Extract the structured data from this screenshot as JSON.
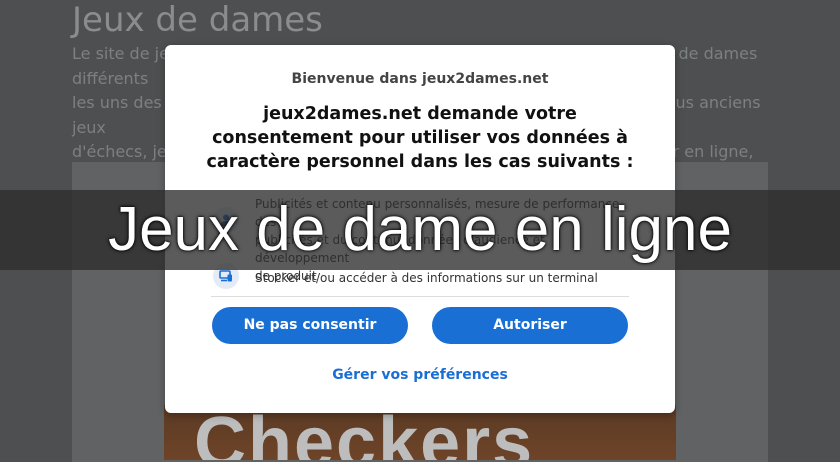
{
  "page": {
    "title": "Jeux de dames",
    "description": "Le site de jeux de dames en ligne permet de jouer gratuitement à des jeux de dames différents\nles uns des autres. Le jeu de dames est, comme le jeu d'échecs, l'un des plus anciens jeux\nd'échecs, jeux de stratégie, qui peuvent se jouer en solo contre l'ordinateur en ligne, sans\navoir besoin de télécharger, ni d'installer de logiciel. Le joueur est tout de suite amené,..."
  },
  "game_image": {
    "text": "Checkers"
  },
  "consent_modal": {
    "header": "Bienvenue dans jeux2dames.net",
    "heading": "jeux2dames.net demande votre\nconsentement pour utiliser vos données à\ncaractère personnel dans les cas suivants :",
    "purposes": [
      {
        "icon": "person-icon",
        "text": "Publicités et contenu personnalisés, mesure de performance des\npublicités et du contenu, données d'audience et développement\nde produit"
      },
      {
        "icon": "device-icon",
        "text": "Stocker et/ou accéder à des informations sur un terminal"
      }
    ],
    "buttons": {
      "reject": "Ne pas consentir",
      "accept": "Autoriser"
    },
    "manage_link": "Gérer vos préférences"
  },
  "banner": {
    "title": "Jeux de dame en ligne"
  },
  "colors": {
    "accent": "#1a6fd4",
    "overlay": "#4d4f50"
  }
}
